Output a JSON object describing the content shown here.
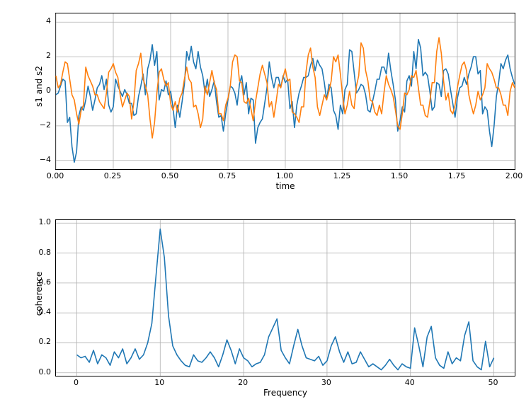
{
  "chart_data": [
    {
      "type": "line",
      "title": "",
      "xlabel": "time",
      "ylabel": "s1 and s2",
      "xlim": [
        0.0,
        2.0
      ],
      "ylim": [
        -4.5,
        4.5
      ],
      "xticks": [
        0.0,
        0.25,
        0.5,
        0.75,
        1.0,
        1.25,
        1.5,
        1.75,
        2.0
      ],
      "yticks": [
        -4,
        -2,
        0,
        2,
        4
      ],
      "grid": true,
      "series": [
        {
          "name": "s1",
          "color": "#1f77b4",
          "x_step": 0.01,
          "values": [
            -0.2,
            -0.1,
            0.3,
            0.7,
            0.6,
            -1.8,
            -1.5,
            -3.2,
            -4.1,
            -3.5,
            -1.4,
            -0.9,
            -1.1,
            -0.5,
            0.3,
            -0.3,
            -1.1,
            -0.5,
            0.2,
            0.4,
            0.9,
            0.1,
            0.7,
            -0.8,
            -1.2,
            -0.9,
            0.7,
            0.3,
            0.0,
            -0.3,
            0.1,
            -0.2,
            -0.7,
            -0.7,
            -1.4,
            -1.3,
            -0.3,
            0.3,
            1.0,
            -0.2,
            1.3,
            1.8,
            2.7,
            1.5,
            2.3,
            -0.5,
            0.1,
            0.0,
            0.6,
            -0.2,
            0.0,
            -0.9,
            -2.1,
            -0.8,
            -1.5,
            -0.6,
            0.4,
            2.3,
            1.8,
            2.6,
            1.7,
            1.3,
            2.3,
            1.4,
            0.9,
            -0.1,
            0.7,
            -0.3,
            0.1,
            0.6,
            -0.6,
            -1.5,
            -1.4,
            -2.3,
            -1.3,
            -0.5,
            0.3,
            0.2,
            -0.1,
            -0.8,
            0.4,
            0.9,
            -0.2,
            0.5,
            -1.3,
            -0.4,
            -0.5,
            -3.0,
            -2.1,
            -1.8,
            -1.6,
            -0.7,
            0.2,
            1.7,
            0.8,
            0.2,
            0.8,
            0.8,
            0.2,
            0.9,
            0.5,
            0.7,
            -1.0,
            -0.6,
            -2.1,
            -0.8,
            -0.1,
            0.3,
            0.8,
            0.8,
            0.9,
            1.5,
            1.9,
            1.2,
            1.8,
            1.5,
            1.3,
            0.5,
            -0.5,
            0.4,
            0.2,
            -1.1,
            -1.4,
            -2.2,
            -0.8,
            -1.3,
            0.1,
            0.4,
            2.4,
            2.3,
            1.1,
            -0.1,
            0.1,
            0.4,
            0.3,
            -0.2,
            -1.1,
            -1.2,
            -0.6,
            0.0,
            0.7,
            0.7,
            1.4,
            1.4,
            1.0,
            2.2,
            1.2,
            0.4,
            -0.5,
            -2.3,
            -1.7,
            -0.9,
            -1.2,
            0.6,
            0.9,
            0.3,
            2.3,
            1.3,
            3.0,
            2.5,
            0.9,
            1.1,
            0.9,
            0.0,
            -1.1,
            -0.9,
            0.5,
            0.4,
            -0.3,
            1.2,
            1.3,
            1.0,
            0.1,
            -0.7,
            -1.5,
            -0.4,
            0.2,
            0.3,
            0.8,
            0.4,
            1.0,
            1.4,
            2.0,
            2.0,
            1.0,
            1.2,
            -1.3,
            -0.9,
            -1.1,
            -2.3,
            -3.2,
            -2.0,
            -0.3,
            0.5,
            1.6,
            1.3,
            1.8,
            2.1,
            1.3,
            0.8,
            0.4
          ]
        },
        {
          "name": "s2",
          "color": "#ff7f0e",
          "x_step": 0.01,
          "values": [
            0.9,
            0.2,
            0.4,
            1.1,
            1.7,
            1.6,
            0.7,
            -0.2,
            -0.5,
            -1.3,
            -1.9,
            -1.1,
            -0.8,
            1.4,
            0.9,
            0.6,
            0.3,
            -0.2,
            -0.2,
            -0.6,
            -0.8,
            -1.0,
            -0.1,
            1.1,
            1.3,
            1.6,
            1.1,
            0.8,
            -0.2,
            -0.9,
            -0.5,
            -0.1,
            -0.3,
            -1.6,
            -0.6,
            1.2,
            1.6,
            2.2,
            0.7,
            0.3,
            -0.2,
            -1.6,
            -2.7,
            -1.8,
            -0.1,
            1.1,
            1.3,
            0.7,
            0.3,
            0.5,
            -0.7,
            -1.1,
            -0.6,
            -1.2,
            -0.4,
            -0.1,
            0.7,
            1.4,
            0.7,
            0.5,
            -0.9,
            -0.8,
            -1.3,
            -2.1,
            -1.6,
            0.3,
            -0.2,
            0.5,
            1.2,
            0.5,
            0.1,
            -1.3,
            -1.3,
            -1.7,
            -0.8,
            -0.4,
            0.3,
            1.7,
            2.1,
            2.0,
            0.6,
            0.5,
            -0.6,
            -0.7,
            -0.4,
            -1.0,
            -1.7,
            -0.6,
            0.2,
            1.0,
            1.5,
            1.0,
            0.5,
            -0.9,
            -0.6,
            -1.5,
            -0.6,
            0.4,
            0.2,
            0.8,
            1.3,
            0.6,
            0.7,
            -1.2,
            -1.3,
            -1.5,
            -1.8,
            -0.9,
            -0.9,
            1.1,
            2.1,
            2.5,
            1.4,
            0.8,
            -0.9,
            -1.4,
            -0.8,
            -0.2,
            -0.5,
            0.0,
            0.6,
            2.0,
            1.7,
            2.1,
            1.0,
            -0.3,
            -1.3,
            -0.8,
            0.0,
            -0.8,
            -1.0,
            0.3,
            0.9,
            2.8,
            2.5,
            1.2,
            0.6,
            -0.5,
            -0.6,
            -1.2,
            -1.4,
            -0.8,
            -1.3,
            -0.1,
            0.9,
            0.4,
            0.1,
            -0.3,
            -1.1,
            -2.0,
            -2.2,
            -1.3,
            -0.1,
            -0.2,
            0.1,
            0.9,
            0.8,
            1.2,
            0.2,
            -0.8,
            -0.8,
            -1.4,
            -1.5,
            -0.6,
            0.5,
            0.5,
            2.3,
            3.1,
            2.2,
            0.6,
            -0.5,
            -0.1,
            -1.1,
            -1.3,
            -0.8,
            0.2,
            0.9,
            1.5,
            1.7,
            1.2,
            -0.2,
            -0.8,
            -1.3,
            -0.8,
            0.0,
            -0.5,
            -0.2,
            0.2,
            1.6,
            1.3,
            1.1,
            0.7,
            0.2,
            0.2,
            -0.2,
            -0.8,
            -0.8,
            -1.4,
            0.0,
            0.5,
            0.2
          ]
        }
      ]
    },
    {
      "type": "line",
      "title": "",
      "xlabel": "Frequency",
      "ylabel": "coherence",
      "grid": true,
      "xlim": [
        -2.5,
        52.5
      ],
      "ylim": [
        -0.02,
        1.02
      ],
      "xticks": [
        0,
        10,
        20,
        30,
        40,
        50
      ],
      "yticks": [
        0.0,
        0.2,
        0.4,
        0.6,
        0.8,
        1.0
      ],
      "series": [
        {
          "name": "coherence",
          "color": "#1f77b4",
          "x": [
            0,
            0.5,
            1,
            1.5,
            2,
            2.5,
            3,
            3.5,
            4,
            4.5,
            5,
            5.5,
            6,
            6.5,
            7,
            7.5,
            8,
            8.5,
            9,
            9.5,
            10,
            10.5,
            11,
            11.5,
            12,
            12.5,
            13,
            13.5,
            14,
            14.5,
            15,
            15.5,
            16,
            16.5,
            17,
            17.5,
            18,
            18.5,
            19,
            19.5,
            20,
            20.5,
            21,
            21.5,
            22,
            22.5,
            23,
            23.5,
            24,
            24.5,
            25,
            25.5,
            26,
            26.5,
            27,
            27.5,
            28,
            28.5,
            29,
            29.5,
            30,
            30.5,
            31,
            31.5,
            32,
            32.5,
            33,
            33.5,
            34,
            34.5,
            35,
            35.5,
            36,
            36.5,
            37,
            37.5,
            38,
            38.5,
            39,
            39.5,
            40,
            40.5,
            41,
            41.5,
            42,
            42.5,
            43,
            43.5,
            44,
            44.5,
            45,
            45.5,
            46,
            46.5,
            47,
            47.5,
            48,
            48.5,
            49,
            49.5,
            50
          ],
          "values": [
            0.12,
            0.1,
            0.11,
            0.07,
            0.15,
            0.06,
            0.12,
            0.1,
            0.05,
            0.14,
            0.1,
            0.16,
            0.06,
            0.1,
            0.16,
            0.09,
            0.12,
            0.2,
            0.33,
            0.65,
            0.96,
            0.77,
            0.38,
            0.18,
            0.12,
            0.08,
            0.05,
            0.04,
            0.12,
            0.08,
            0.07,
            0.1,
            0.14,
            0.1,
            0.04,
            0.12,
            0.22,
            0.15,
            0.06,
            0.16,
            0.1,
            0.08,
            0.04,
            0.06,
            0.07,
            0.12,
            0.24,
            0.3,
            0.36,
            0.15,
            0.1,
            0.06,
            0.18,
            0.29,
            0.18,
            0.1,
            0.09,
            0.08,
            0.11,
            0.05,
            0.08,
            0.18,
            0.24,
            0.14,
            0.07,
            0.14,
            0.06,
            0.07,
            0.14,
            0.09,
            0.04,
            0.06,
            0.04,
            0.02,
            0.05,
            0.09,
            0.05,
            0.02,
            0.06,
            0.04,
            0.03,
            0.3,
            0.18,
            0.04,
            0.24,
            0.31,
            0.1,
            0.05,
            0.03,
            0.14,
            0.06,
            0.1,
            0.08,
            0.25,
            0.34,
            0.08,
            0.04,
            0.02,
            0.21,
            0.04,
            0.1
          ]
        }
      ]
    }
  ],
  "labels": {
    "top_xlabel": "time",
    "top_ylabel": "s1 and s2",
    "bottom_xlabel": "Frequency",
    "bottom_ylabel": "coherence",
    "top_xticks": [
      "0.00",
      "0.25",
      "0.50",
      "0.75",
      "1.00",
      "1.25",
      "1.50",
      "1.75",
      "2.00"
    ],
    "top_yticks": [
      "−4",
      "−2",
      "0",
      "2",
      "4"
    ],
    "bottom_xticks": [
      "0",
      "10",
      "20",
      "30",
      "40",
      "50"
    ],
    "bottom_yticks": [
      "0.0",
      "0.2",
      "0.4",
      "0.6",
      "0.8",
      "1.0"
    ]
  }
}
